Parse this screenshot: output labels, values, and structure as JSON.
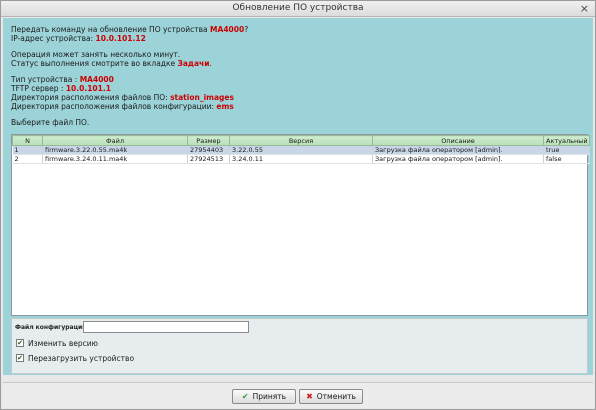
{
  "window": {
    "title": "Обновление ПО устройства",
    "close_glyph": "×"
  },
  "info": {
    "line1_prefix": "Передать команду на обновление ПО устройства ",
    "device_model": "MA4000",
    "line1_suffix": "?",
    "ip_label": "IP-адрес устройства: ",
    "ip_value": "10.0.101.12",
    "op_note1": "Операция может занять несколько минут.",
    "op_note2_prefix": "Статус выполнения смотрите во вкладке ",
    "op_note2_link": "Задачи",
    "op_note2_suffix": ".",
    "type_label": "Тип устройства : ",
    "type_value": "MA4000",
    "tftp_label": "TFTP сервер : ",
    "tftp_value": "10.0.101.1",
    "fw_dir_label": "Директория расположения файлов ПО: ",
    "fw_dir_value": "station_images",
    "cfg_dir_label": "Директория расположения файлов конфигурации: ",
    "cfg_dir_value": "ems",
    "choose": "Выберите файл ПО."
  },
  "table": {
    "columns": [
      "N",
      "Файл",
      "Размер",
      "Версия",
      "Описание",
      "Актуальный"
    ],
    "rows": [
      [
        "1",
        "firmware.3.22.0.55.ma4k",
        "27954403",
        "3.22.0.55",
        "Загрузка файла оператором [admin].",
        "true"
      ],
      [
        "2",
        "firmware.3.24.0.11.ma4k",
        "27924513",
        "3.24.0.11",
        "Загрузка файла оператором [admin].",
        "false"
      ]
    ]
  },
  "config": {
    "label": "Файл конфигурации",
    "value": "",
    "placeholder": ""
  },
  "options": {
    "change_version": {
      "label": "Изменить версию",
      "checked": true,
      "mark": "✔"
    },
    "reboot": {
      "label": "Перезагрузить устройство",
      "checked": true,
      "mark": "✔"
    }
  },
  "buttons": {
    "ok": "Принять",
    "cancel": "Отменить",
    "ok_icon": "✔",
    "cancel_icon": "✖"
  }
}
